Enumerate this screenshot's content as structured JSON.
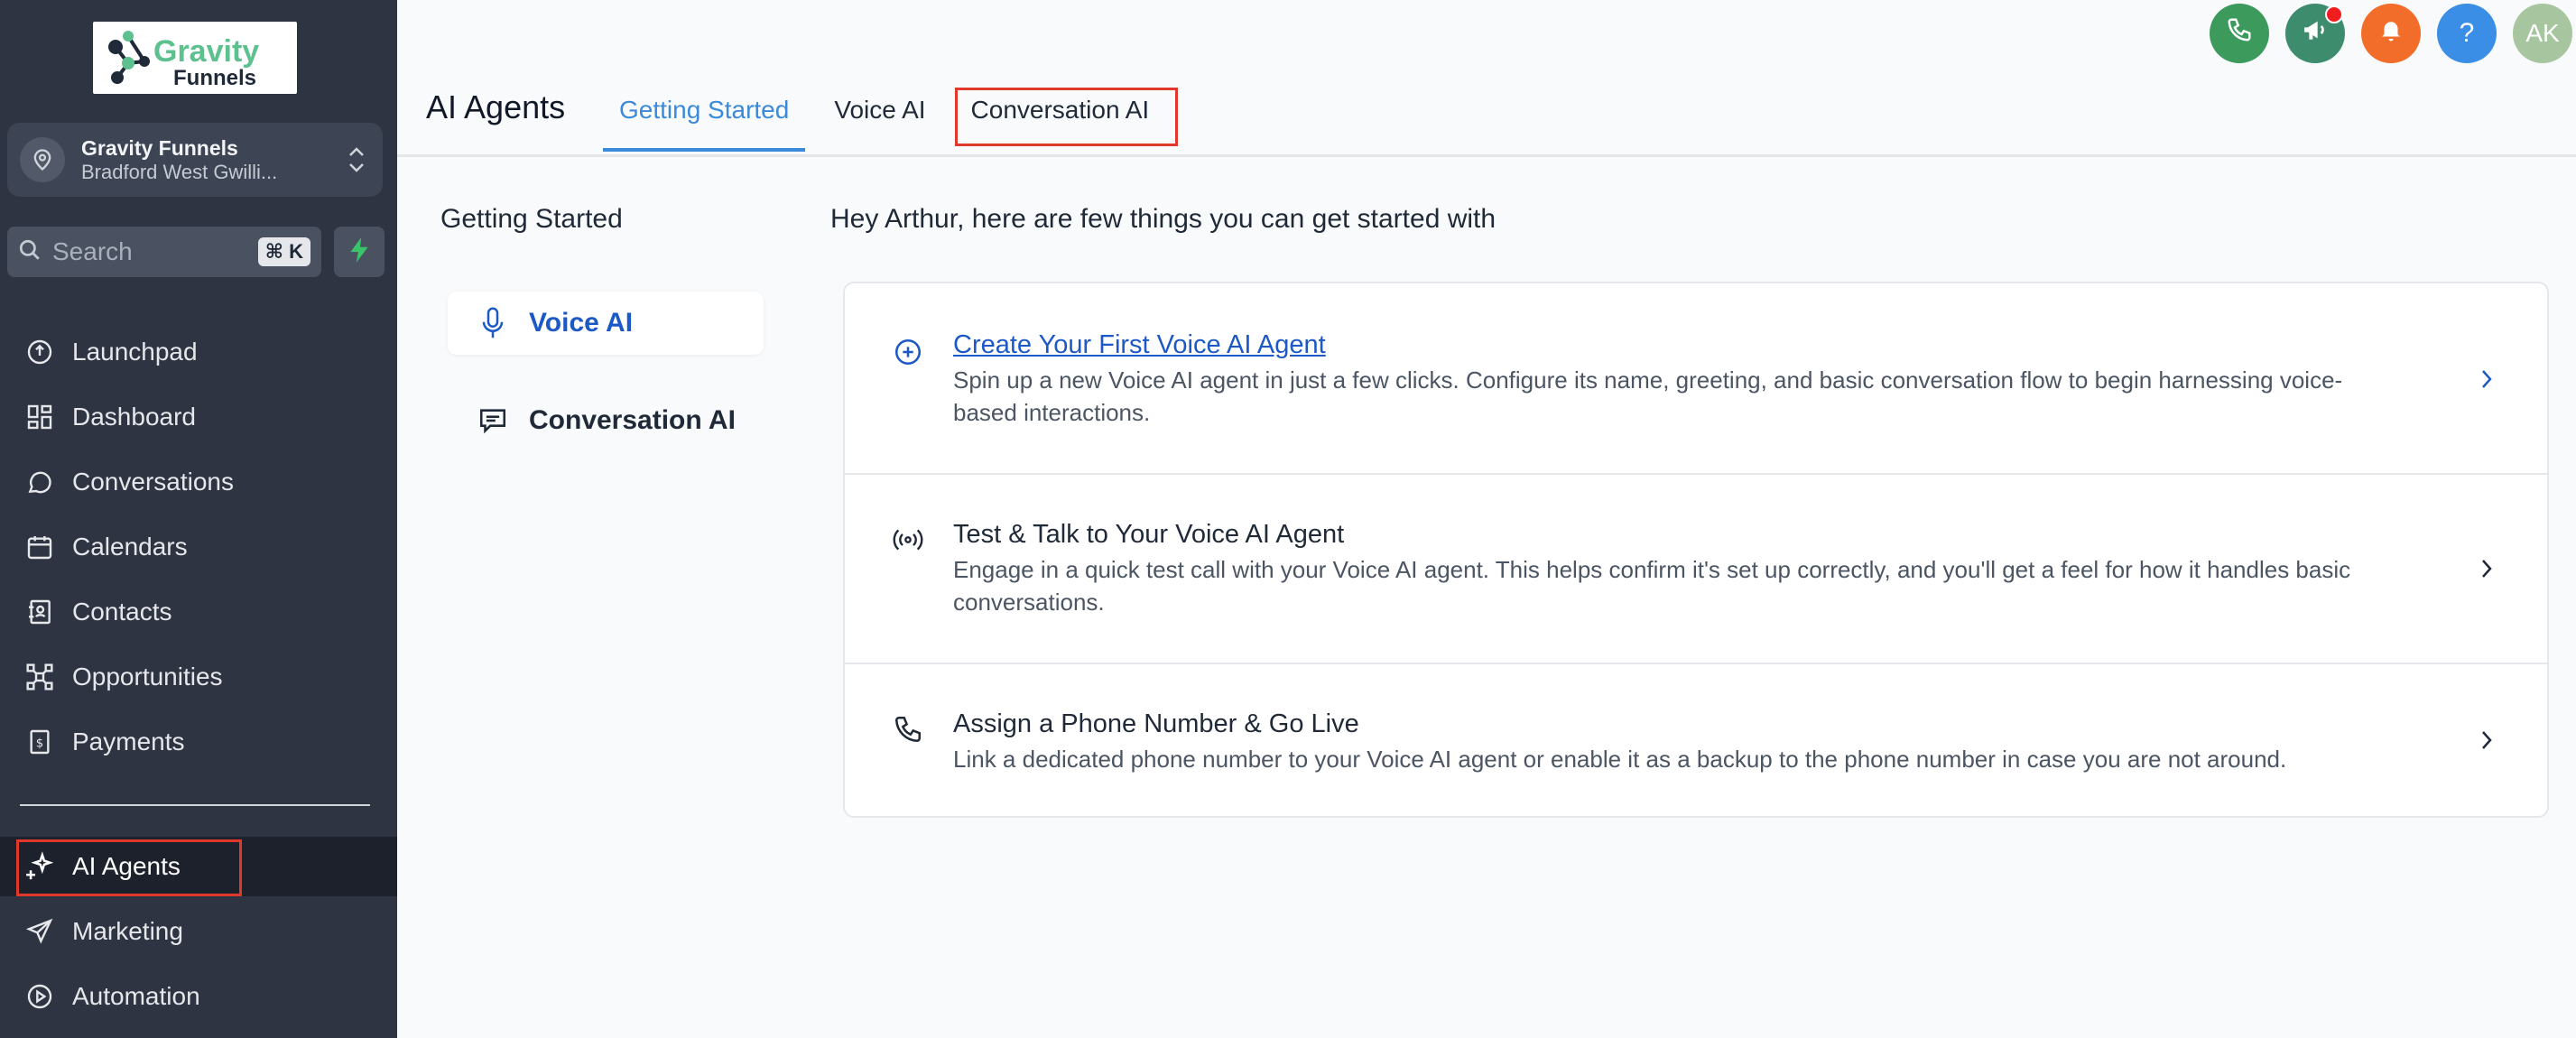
{
  "brand": {
    "logo_word1": "Gravity",
    "logo_word2": "Funnels",
    "green": "#5cc08f"
  },
  "account": {
    "name": "Gravity Funnels",
    "location": "Bradford West Gwilli..."
  },
  "search": {
    "placeholder": "Search",
    "shortcut": "⌘ K"
  },
  "sidebar": {
    "items": [
      {
        "label": "Launchpad",
        "icon": "rocket-icon"
      },
      {
        "label": "Dashboard",
        "icon": "grid-icon"
      },
      {
        "label": "Conversations",
        "icon": "chat-bubble-icon"
      },
      {
        "label": "Calendars",
        "icon": "calendar-icon"
      },
      {
        "label": "Contacts",
        "icon": "address-book-icon"
      },
      {
        "label": "Opportunities",
        "icon": "network-icon"
      },
      {
        "label": "Payments",
        "icon": "receipt-icon"
      },
      {
        "label": "AI Agents",
        "icon": "sparkle-icon",
        "active": true
      },
      {
        "label": "Marketing",
        "icon": "paper-plane-icon"
      },
      {
        "label": "Automation",
        "icon": "play-circle-icon"
      }
    ]
  },
  "topbar": {
    "phone_color": "#3c9a5c",
    "announce_color": "#3c8c6d",
    "bell_color": "#f36d2a",
    "help_color": "#3a8ee6",
    "help_label": "?",
    "avatar_initials": "AK"
  },
  "header": {
    "title": "AI Agents",
    "tabs": [
      {
        "label": "Getting Started",
        "active": true
      },
      {
        "label": "Voice AI"
      },
      {
        "label": "Conversation AI"
      }
    ]
  },
  "submenu": {
    "title": "Getting Started",
    "items": [
      {
        "label": "Voice AI",
        "icon": "microphone-icon",
        "active": true
      },
      {
        "label": "Conversation AI",
        "icon": "message-square-icon"
      }
    ]
  },
  "main": {
    "greeting": "Hey Arthur, here are few things you can get started with",
    "rows": [
      {
        "title": "Create Your First Voice AI Agent",
        "desc": "Spin up a new Voice AI agent in just a few clicks. Configure its name, greeting, and basic conversation flow to begin harnessing voice-based interactions.",
        "icon": "plus-circle-icon"
      },
      {
        "title": "Test & Talk to Your Voice AI Agent",
        "desc": "Engage in a quick test call with your Voice AI agent. This helps confirm it's set up correctly, and you'll get a feel for how it handles basic conversations.",
        "icon": "broadcast-icon"
      },
      {
        "title": "Assign a Phone Number & Go Live",
        "desc": "Link a dedicated phone number to your Voice AI agent or enable it as a backup to the phone number in case you are not around.",
        "icon": "phone-icon"
      }
    ]
  }
}
